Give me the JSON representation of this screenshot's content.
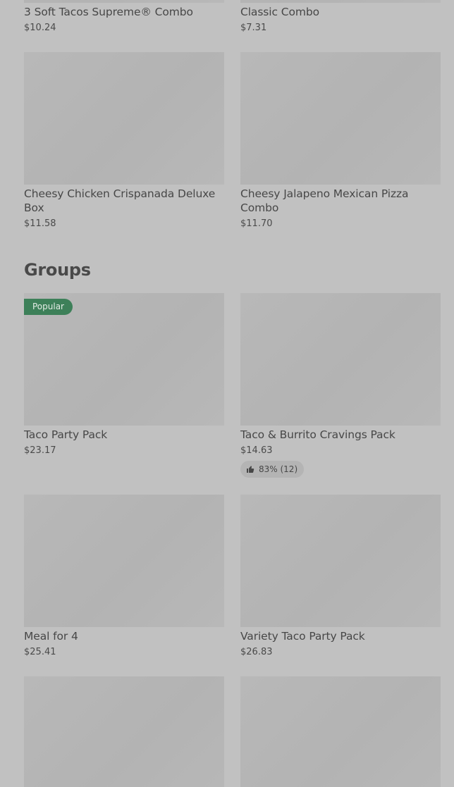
{
  "combos": [
    {
      "name": "3 Soft Tacos Supreme® Combo",
      "price": "$10.24"
    },
    {
      "name": "Classic Combo",
      "price": "$7.31"
    },
    {
      "name": "Cheesy Chicken Crispanada Deluxe Box",
      "price": "$11.58"
    },
    {
      "name": "Cheesy Jalapeno Mexican Pizza Combo",
      "price": "$11.70"
    }
  ],
  "groups": {
    "title": "Groups",
    "items": [
      {
        "name": "Taco Party Pack",
        "price": "$23.17",
        "badge": "Popular"
      },
      {
        "name": "Taco & Burrito Cravings Pack",
        "price": "$14.63",
        "rating": "83% (12)",
        "rating_icon": "thumbs-up-icon"
      },
      {
        "name": "Meal for 4",
        "price": "$25.41"
      },
      {
        "name": "Variety Taco Party Pack",
        "price": "$26.83"
      }
    ]
  },
  "colors": {
    "background": "#c1c1c1",
    "thumbnail": "#b6b6b6",
    "popular_badge": "#3d8059",
    "text": "#474747"
  }
}
